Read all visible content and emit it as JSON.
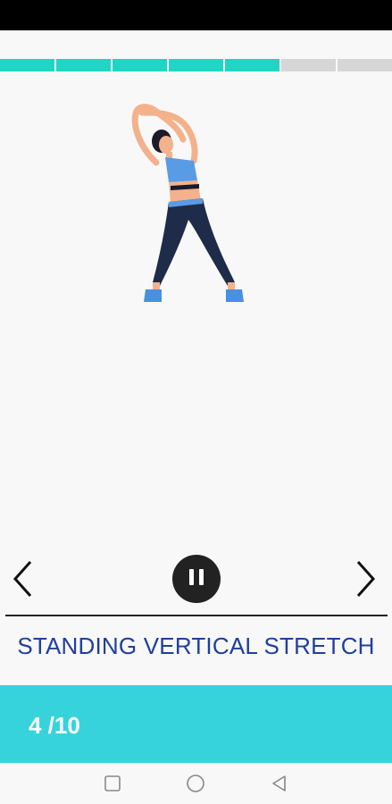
{
  "progress": {
    "completed_segments": 5,
    "total_segments": 7,
    "done_color": "#1fd6c4",
    "pending_color": "#d6d6d6"
  },
  "illustration": {
    "icon": "woman-side-stretch-illustration"
  },
  "controls": {
    "prev_icon": "chevron-left-icon",
    "pause_icon": "pause-icon",
    "next_icon": "chevron-right-icon"
  },
  "exercise": {
    "title": "STANDING VERTICAL STRETCH",
    "title_color": "#1f3f9f"
  },
  "footer": {
    "counter": "4 /10",
    "band_color": "#37d3dc"
  },
  "system_nav": {
    "recents_icon": "square-icon",
    "home_icon": "circle-icon",
    "back_icon": "triangle-back-icon"
  }
}
